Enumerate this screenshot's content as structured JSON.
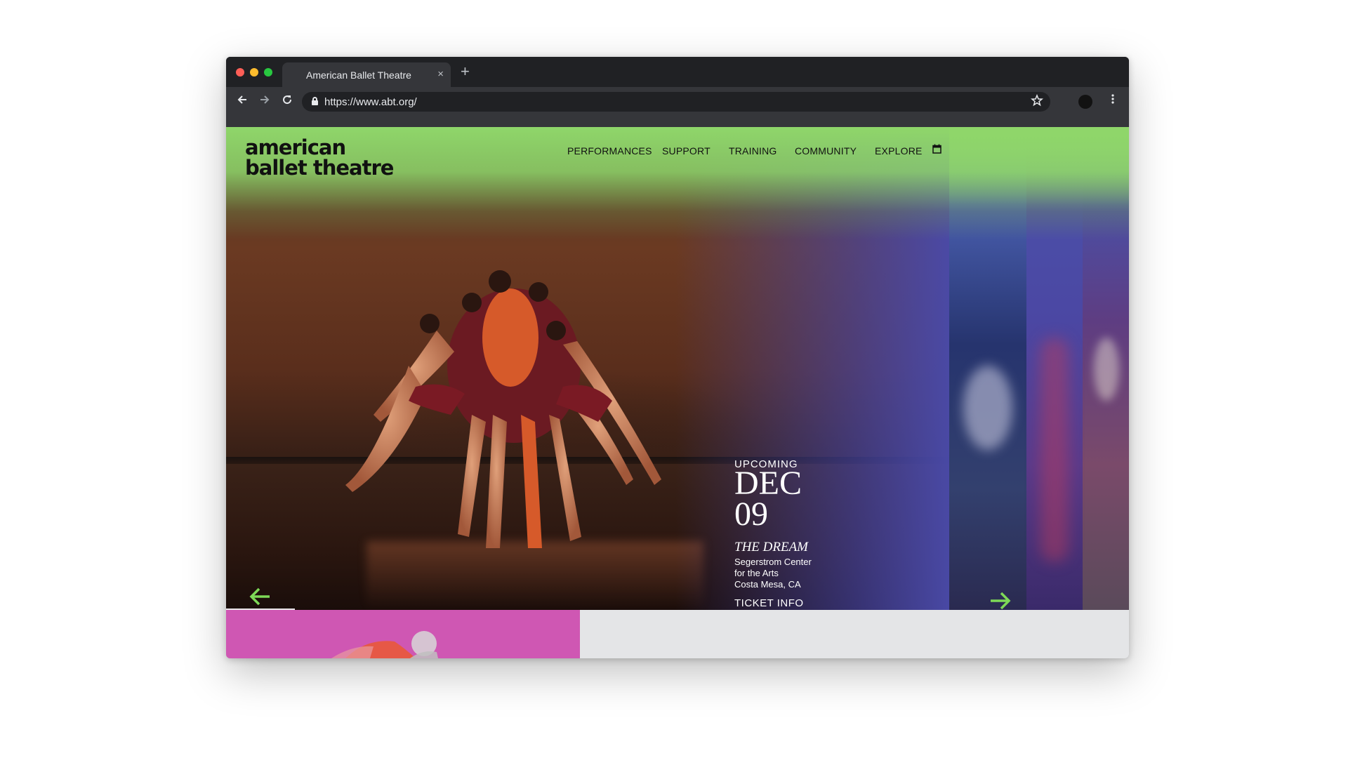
{
  "browser": {
    "tab_title": "American Ballet Theatre",
    "tab_close_glyph": "×",
    "new_tab_glyph": "+",
    "url": "https://www.abt.org/",
    "icons": [
      "back-arrow-icon",
      "forward-arrow-icon",
      "reload-icon",
      "lock-icon",
      "star-icon",
      "profile-icon",
      "menu-icon"
    ]
  },
  "site": {
    "logo_text": "american ballet theatre",
    "nav": {
      "performances": "PERFORMANCES",
      "support": "SUPPORT",
      "training": "TRAINING",
      "community": "COMMUNITY",
      "explore": "EXPLORE"
    },
    "colors": {
      "green": "#8fd66a",
      "purple": "#4a4aa8",
      "pink": "#cf57b3",
      "arrow": "#7ed957"
    }
  },
  "hero": {
    "kicker": "UPCOMING",
    "month": "DEC",
    "day": "09",
    "title": "THE DREAM",
    "venue_line_1": "Segerstrom Center",
    "venue_line_2": "for the Arts",
    "venue_line_3": "Costa Mesa, CA",
    "ticket_label": "TICKET INFO"
  }
}
